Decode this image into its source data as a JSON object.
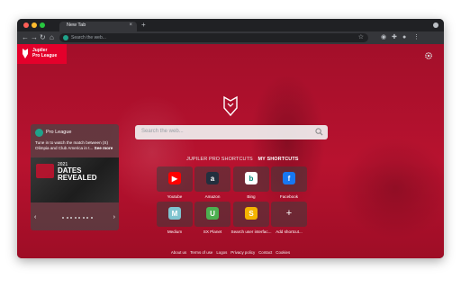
{
  "browser": {
    "tab_title": "New Tab",
    "tab_close": "×",
    "new_tab": "+",
    "omnibox_placeholder": "Search the web...",
    "icons": [
      "back-icon",
      "forward-icon",
      "reload-icon",
      "home-icon",
      "star-icon",
      "extension-icon",
      "puzzle-icon",
      "profile-icon",
      "menu-icon"
    ]
  },
  "brand": {
    "logo_line1": "Jupiler",
    "logo_line2": "Pro League",
    "accent": "#e4002b",
    "background": "#b8122f"
  },
  "search": {
    "placeholder": "Search the web..."
  },
  "shortcut_tabs": {
    "tab1": "JUPILER PRO SHORTCUTS",
    "tab2": "MY SHORTCUTS"
  },
  "shortcuts": [
    {
      "label": "Youtube",
      "icon": "youtube-icon",
      "color": "#ff0000",
      "glyph": "▶"
    },
    {
      "label": "Amazon",
      "icon": "amazon-icon",
      "color": "#232f3e",
      "glyph": "a"
    },
    {
      "label": "Bing",
      "icon": "bing-icon",
      "color": "#ffffff",
      "glyph": "b"
    },
    {
      "label": "Facebook",
      "icon": "facebook-icon",
      "color": "#1877f2",
      "glyph": "f"
    },
    {
      "label": "Medium",
      "icon": "medium-icon",
      "color": "#7ec4cf",
      "glyph": "M"
    },
    {
      "label": "SX Planet",
      "icon": "sx-planet-icon",
      "color": "#4caf50",
      "glyph": "U"
    },
    {
      "label": "Search user interfac...",
      "icon": "search-ui-icon",
      "color": "#f4b400",
      "glyph": "S"
    },
    {
      "label": "Add shortcut...",
      "icon": "plus-icon",
      "color": "",
      "glyph": "+"
    }
  ],
  "news": {
    "source": "Pro League",
    "text": "Tune in to watch the match between (S) Olimpia and Club America in t...",
    "more": "See more",
    "image_year": "2021",
    "image_title_1": "DATES",
    "image_title_2": "REVEALED",
    "prev": "‹",
    "next": "›",
    "slides": 8
  },
  "footer": [
    "About us",
    "Terms of use",
    "Logos",
    "Privacy policy",
    "Contact",
    "Cookies"
  ]
}
